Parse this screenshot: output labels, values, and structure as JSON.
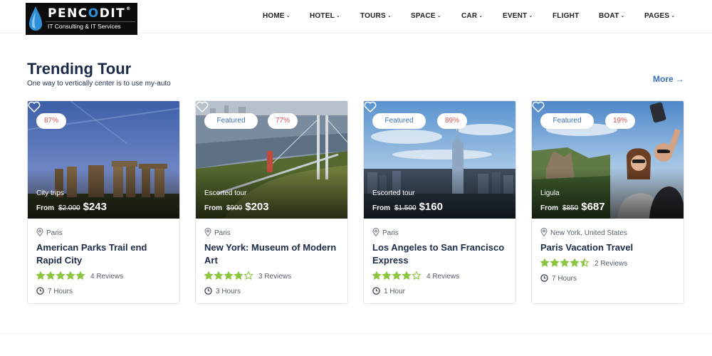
{
  "logo": {
    "brand_prefix": "PENC",
    "brand_o": "O",
    "brand_suffix": "DIT",
    "registered": "®",
    "tagline": "IT Consulting & IT Services"
  },
  "nav": [
    {
      "label": "HOME",
      "dropdown": true
    },
    {
      "label": "HOTEL",
      "dropdown": true
    },
    {
      "label": "TOURS",
      "dropdown": true
    },
    {
      "label": "SPACE",
      "dropdown": true
    },
    {
      "label": "CAR",
      "dropdown": true
    },
    {
      "label": "EVENT",
      "dropdown": true
    },
    {
      "label": "FLIGHT",
      "dropdown": false
    },
    {
      "label": "BOAT",
      "dropdown": true
    },
    {
      "label": "PAGES",
      "dropdown": true
    }
  ],
  "section": {
    "title": "Trending Tour",
    "subtitle": "One way to vertically center is to use my-auto",
    "more_label": "More",
    "more_icon": "arrow-right-icon"
  },
  "colors": {
    "accent": "#3a6fb4",
    "star": "#8bc53f",
    "discount": "#d9534f",
    "heading": "#1a2b49"
  },
  "tours": [
    {
      "featured": null,
      "discount": "87%",
      "category": "City trips",
      "from_label": "From",
      "old_price": "$2.000",
      "price": "$243",
      "location": "Paris",
      "name": "American Parks Trail end Rapid City",
      "rating": 5,
      "reviews": "4 Reviews",
      "duration": "7 Hours"
    },
    {
      "featured": "Featured",
      "discount": "77%",
      "category": "Escorted tour",
      "from_label": "From",
      "old_price": "$900",
      "price": "$203",
      "location": "Paris",
      "name": "New York: Museum of Modern Art",
      "rating": 4,
      "reviews": "3 Reviews",
      "duration": "3 Hours"
    },
    {
      "featured": "Featured",
      "discount": "89%",
      "category": "Escorted tour",
      "from_label": "From",
      "old_price": "$1.500",
      "price": "$160",
      "location": "Paris",
      "name": "Los Angeles to San Francisco Express",
      "rating": 4,
      "reviews": "4 Reviews",
      "duration": "1 Hour"
    },
    {
      "featured": "Featured",
      "discount": "19%",
      "category": "Ligula",
      "from_label": "From",
      "old_price": "$850",
      "price": "$687",
      "location": "New York, United States",
      "name": "Paris Vacation Travel",
      "rating": 4.5,
      "reviews": "2 Reviews",
      "duration": "7 Hours"
    }
  ]
}
